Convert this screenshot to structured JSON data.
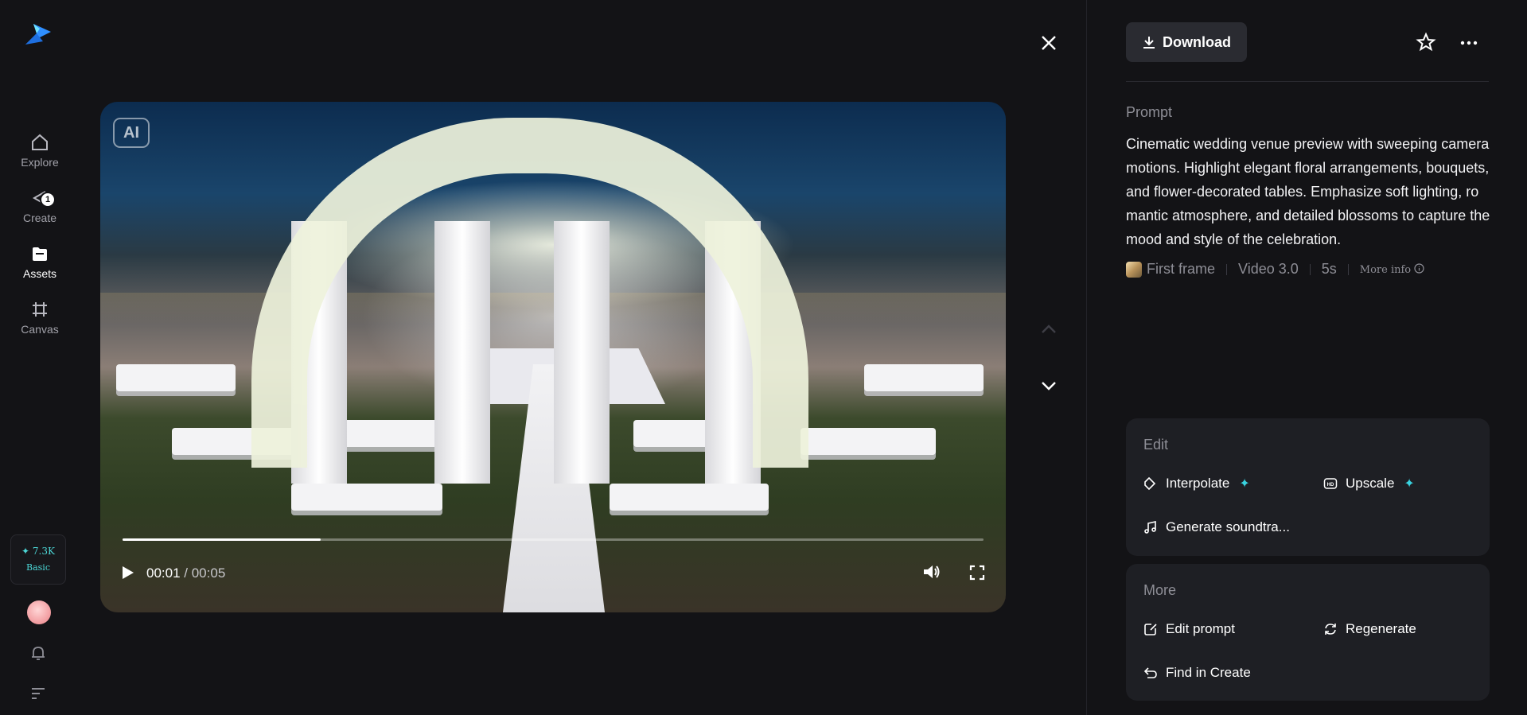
{
  "sidebar": {
    "items": [
      {
        "label": "Explore",
        "icon": "home-icon"
      },
      {
        "label": "Create",
        "icon": "create-icon",
        "badge": "1"
      },
      {
        "label": "Assets",
        "icon": "folder-icon",
        "active": true
      },
      {
        "label": "Canvas",
        "icon": "canvas-icon"
      }
    ],
    "credits": {
      "amount": "✦ 7.3K",
      "plan": "Basic"
    }
  },
  "player": {
    "ai_tag": "AI",
    "current_time": "00:01",
    "duration": "/ 00:05",
    "progress_fraction": 0.23
  },
  "panel": {
    "download_label": "Download",
    "prompt_label": "Prompt",
    "prompt_text": "Cinematic wedding venue preview with sweeping camera motions. Highlight elegant floral arrangements, bouquets, and flower-decorated tables. Emphasize soft lighting, romantic atmosphere, and detailed blossoms to capture the mood and style of the celebration.",
    "meta": {
      "first_frame": "First frame",
      "model": "Video 3.0",
      "length": "5s",
      "more_info": "More info"
    },
    "edit": {
      "title": "Edit",
      "interpolate": "Interpolate",
      "upscale": "Upscale",
      "soundtrack": "Generate soundtra..."
    },
    "more": {
      "title": "More",
      "edit_prompt": "Edit prompt",
      "regenerate": "Regenerate",
      "find_in_create": "Find in Create"
    }
  },
  "colors": {
    "background": "#131316",
    "card": "#1e1f24",
    "accent": "#39d3e0"
  }
}
